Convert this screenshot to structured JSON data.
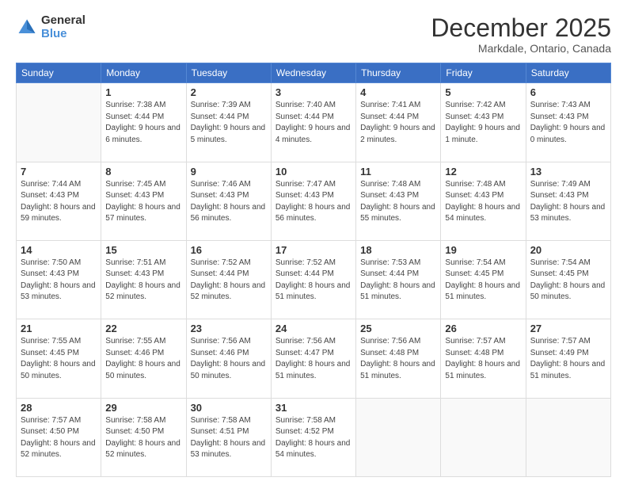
{
  "logo": {
    "general": "General",
    "blue": "Blue"
  },
  "header": {
    "month": "December 2025",
    "location": "Markdale, Ontario, Canada"
  },
  "weekdays": [
    "Sunday",
    "Monday",
    "Tuesday",
    "Wednesday",
    "Thursday",
    "Friday",
    "Saturday"
  ],
  "weeks": [
    [
      {
        "day": "",
        "empty": true
      },
      {
        "day": "1",
        "sunrise": "7:38 AM",
        "sunset": "4:44 PM",
        "daylight": "9 hours and 6 minutes."
      },
      {
        "day": "2",
        "sunrise": "7:39 AM",
        "sunset": "4:44 PM",
        "daylight": "9 hours and 5 minutes."
      },
      {
        "day": "3",
        "sunrise": "7:40 AM",
        "sunset": "4:44 PM",
        "daylight": "9 hours and 4 minutes."
      },
      {
        "day": "4",
        "sunrise": "7:41 AM",
        "sunset": "4:44 PM",
        "daylight": "9 hours and 2 minutes."
      },
      {
        "day": "5",
        "sunrise": "7:42 AM",
        "sunset": "4:43 PM",
        "daylight": "9 hours and 1 minute."
      },
      {
        "day": "6",
        "sunrise": "7:43 AM",
        "sunset": "4:43 PM",
        "daylight": "9 hours and 0 minutes."
      }
    ],
    [
      {
        "day": "7",
        "sunrise": "7:44 AM",
        "sunset": "4:43 PM",
        "daylight": "8 hours and 59 minutes."
      },
      {
        "day": "8",
        "sunrise": "7:45 AM",
        "sunset": "4:43 PM",
        "daylight": "8 hours and 57 minutes."
      },
      {
        "day": "9",
        "sunrise": "7:46 AM",
        "sunset": "4:43 PM",
        "daylight": "8 hours and 56 minutes."
      },
      {
        "day": "10",
        "sunrise": "7:47 AM",
        "sunset": "4:43 PM",
        "daylight": "8 hours and 56 minutes."
      },
      {
        "day": "11",
        "sunrise": "7:48 AM",
        "sunset": "4:43 PM",
        "daylight": "8 hours and 55 minutes."
      },
      {
        "day": "12",
        "sunrise": "7:48 AM",
        "sunset": "4:43 PM",
        "daylight": "8 hours and 54 minutes."
      },
      {
        "day": "13",
        "sunrise": "7:49 AM",
        "sunset": "4:43 PM",
        "daylight": "8 hours and 53 minutes."
      }
    ],
    [
      {
        "day": "14",
        "sunrise": "7:50 AM",
        "sunset": "4:43 PM",
        "daylight": "8 hours and 53 minutes."
      },
      {
        "day": "15",
        "sunrise": "7:51 AM",
        "sunset": "4:43 PM",
        "daylight": "8 hours and 52 minutes."
      },
      {
        "day": "16",
        "sunrise": "7:52 AM",
        "sunset": "4:44 PM",
        "daylight": "8 hours and 52 minutes."
      },
      {
        "day": "17",
        "sunrise": "7:52 AM",
        "sunset": "4:44 PM",
        "daylight": "8 hours and 51 minutes."
      },
      {
        "day": "18",
        "sunrise": "7:53 AM",
        "sunset": "4:44 PM",
        "daylight": "8 hours and 51 minutes."
      },
      {
        "day": "19",
        "sunrise": "7:54 AM",
        "sunset": "4:45 PM",
        "daylight": "8 hours and 51 minutes."
      },
      {
        "day": "20",
        "sunrise": "7:54 AM",
        "sunset": "4:45 PM",
        "daylight": "8 hours and 50 minutes."
      }
    ],
    [
      {
        "day": "21",
        "sunrise": "7:55 AM",
        "sunset": "4:45 PM",
        "daylight": "8 hours and 50 minutes."
      },
      {
        "day": "22",
        "sunrise": "7:55 AM",
        "sunset": "4:46 PM",
        "daylight": "8 hours and 50 minutes."
      },
      {
        "day": "23",
        "sunrise": "7:56 AM",
        "sunset": "4:46 PM",
        "daylight": "8 hours and 50 minutes."
      },
      {
        "day": "24",
        "sunrise": "7:56 AM",
        "sunset": "4:47 PM",
        "daylight": "8 hours and 51 minutes."
      },
      {
        "day": "25",
        "sunrise": "7:56 AM",
        "sunset": "4:48 PM",
        "daylight": "8 hours and 51 minutes."
      },
      {
        "day": "26",
        "sunrise": "7:57 AM",
        "sunset": "4:48 PM",
        "daylight": "8 hours and 51 minutes."
      },
      {
        "day": "27",
        "sunrise": "7:57 AM",
        "sunset": "4:49 PM",
        "daylight": "8 hours and 51 minutes."
      }
    ],
    [
      {
        "day": "28",
        "sunrise": "7:57 AM",
        "sunset": "4:50 PM",
        "daylight": "8 hours and 52 minutes."
      },
      {
        "day": "29",
        "sunrise": "7:58 AM",
        "sunset": "4:50 PM",
        "daylight": "8 hours and 52 minutes."
      },
      {
        "day": "30",
        "sunrise": "7:58 AM",
        "sunset": "4:51 PM",
        "daylight": "8 hours and 53 minutes."
      },
      {
        "day": "31",
        "sunrise": "7:58 AM",
        "sunset": "4:52 PM",
        "daylight": "8 hours and 54 minutes."
      },
      {
        "day": "",
        "empty": true
      },
      {
        "day": "",
        "empty": true
      },
      {
        "day": "",
        "empty": true
      }
    ]
  ],
  "labels": {
    "sunrise": "Sunrise:",
    "sunset": "Sunset:",
    "daylight": "Daylight:"
  }
}
